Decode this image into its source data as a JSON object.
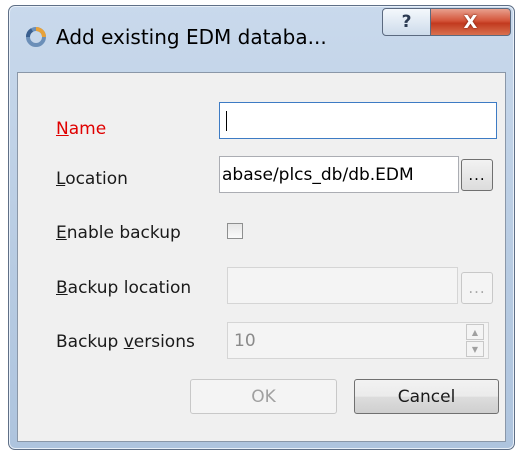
{
  "window": {
    "title": "Add existing EDM databa...",
    "help_glyph": "?",
    "close_glyph": "X"
  },
  "form": {
    "name": {
      "label_first": "N",
      "label_rest": "ame",
      "value": ""
    },
    "location": {
      "label_first": "L",
      "label_rest": "ocation",
      "value": "abase/plcs_db/db.EDM",
      "browse_label": "..."
    },
    "enable_backup": {
      "label_first": "E",
      "label_rest": "nable backup",
      "checked": false
    },
    "backup_location": {
      "label_first": "B",
      "label_rest": "ackup location",
      "value": "",
      "browse_label": "..."
    },
    "backup_versions": {
      "label_pre": "Backup ",
      "label_u": "v",
      "label_rest": "ersions",
      "value": "10",
      "up": "▲",
      "down": "▼"
    }
  },
  "buttons": {
    "ok": "OK",
    "cancel": "Cancel"
  },
  "colors": {
    "required_label": "#e00000",
    "focus_border": "#3d7bc4",
    "close_red": "#c23a1f"
  }
}
